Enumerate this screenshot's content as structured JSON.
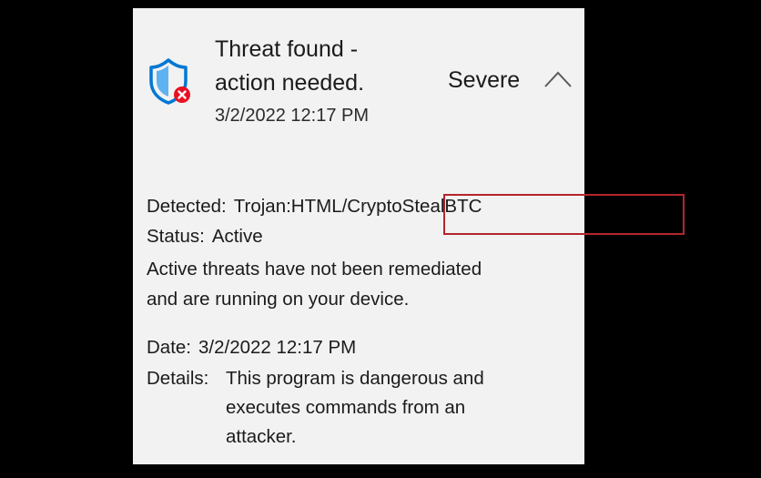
{
  "notification": {
    "title_line1": "Threat found -",
    "title_line2": "action needed.",
    "timestamp": "3/2/2022 12:17 PM",
    "severity": "Severe",
    "icon": "shield-error-icon",
    "expand_icon": "chevron-up-icon"
  },
  "details": {
    "detected_label": "Detected:",
    "detected_prefix": "Trojan:",
    "detected_value": "HTML/CryptoStealBTC",
    "status_label": "Status:",
    "status_value": "Active",
    "description_line1": "Active threats have not been remediated",
    "description_line2": "and are running on your device.",
    "date_label": "Date:",
    "date_value": "3/2/2022 12:17 PM",
    "details_label": "Details:",
    "details_line1": "This program is dangerous and",
    "details_line2": "executes commands from an",
    "details_line3": "attacker."
  },
  "colors": {
    "panel_background": "#f2f2f2",
    "shield_blue": "#0078d4",
    "error_red": "#e81123",
    "highlight_border": "#b3262c"
  }
}
